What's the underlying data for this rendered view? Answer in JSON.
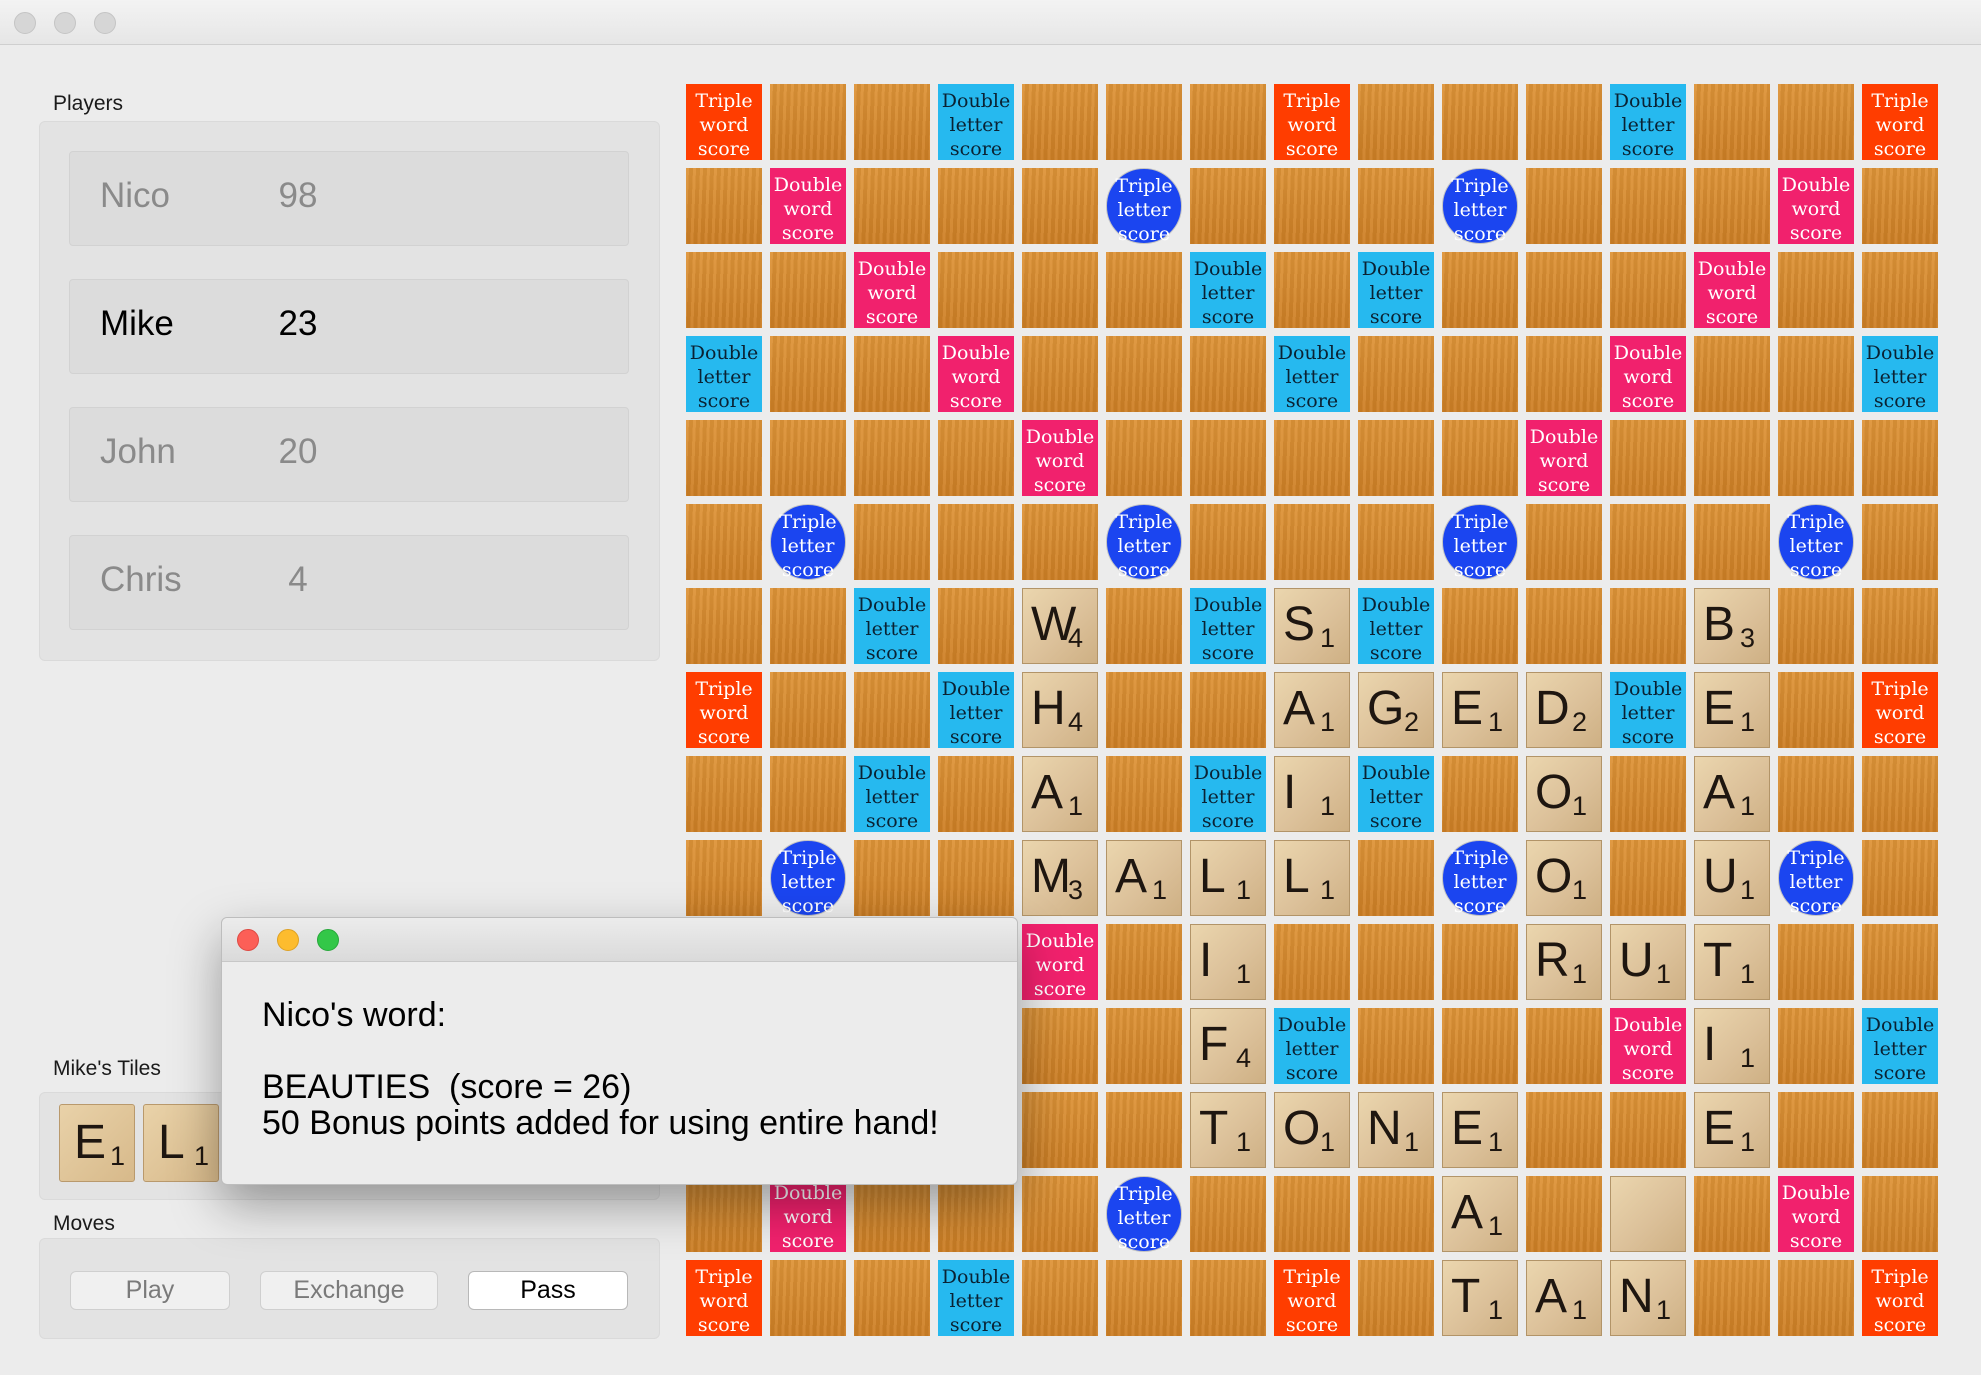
{
  "window": {
    "title": ""
  },
  "players": {
    "label": "Players",
    "list": [
      {
        "name": "Nico",
        "score": "98",
        "active": false
      },
      {
        "name": "Mike",
        "score": "23",
        "active": true
      },
      {
        "name": "John",
        "score": "20",
        "active": false
      },
      {
        "name": "Chris",
        "score": "4",
        "active": false
      }
    ]
  },
  "rack": {
    "label": "Mike's Tiles",
    "tiles": [
      {
        "letter": "E",
        "value": "1"
      },
      {
        "letter": "L",
        "value": "1"
      }
    ]
  },
  "moves": {
    "label": "Moves",
    "buttons": [
      {
        "label": "Play",
        "enabled": false
      },
      {
        "label": "Exchange",
        "enabled": false
      },
      {
        "label": "Pass",
        "enabled": true
      }
    ]
  },
  "premium_labels": {
    "TW": "Triple\nword\nscore",
    "DW": "Double\nword\nscore",
    "TL": "Triple\nletter\nscore",
    "DL": "Double\nletter\nscore"
  },
  "premium_colors": {
    "TW": "#ff3d00",
    "DW": "#f1216d",
    "TL": "#1b45f0",
    "DL": "#26b9ef",
    "plain": "#d88a30"
  },
  "board": {
    "size": 15,
    "premiums": [
      "TW . . DL . . . TW . . . DL . . TW",
      ". DW . . . TL . . . TL . . . DW .",
      ". . DW . . . DL . DL . . . DW . .",
      "DL . . DW . . . DL . . . DW . . DL",
      ". . . . DW . . . . . DW . . . .",
      ". TL . . . TL . . . TL . . . TL .",
      ". . DL . . . DL . DL . . . DL . .",
      "TW . . DL . . . DW . . . DL . . TW",
      ". . DL . . . DL . DL . . . DL . .",
      ". TL . . . TL . . . TL . . . TL .",
      ". . . . DW . . . . . DW . . . .",
      "DL . . DW . . . DL . . . DW . . DL",
      ". . DW . . . DL . DL . . . DW . .",
      ". DW . . . TL . . . TL . . . DW .",
      "TW . . DL . . . TW . . . DL . . TW"
    ],
    "tiles": [
      {
        "row": 6,
        "col": 4,
        "letter": "W",
        "value": "4"
      },
      {
        "row": 6,
        "col": 7,
        "letter": "S",
        "value": "1"
      },
      {
        "row": 6,
        "col": 12,
        "letter": "B",
        "value": "3"
      },
      {
        "row": 7,
        "col": 4,
        "letter": "H",
        "value": "4"
      },
      {
        "row": 7,
        "col": 7,
        "letter": "A",
        "value": "1"
      },
      {
        "row": 7,
        "col": 8,
        "letter": "G",
        "value": "2"
      },
      {
        "row": 7,
        "col": 9,
        "letter": "E",
        "value": "1"
      },
      {
        "row": 7,
        "col": 10,
        "letter": "D",
        "value": "2"
      },
      {
        "row": 7,
        "col": 12,
        "letter": "E",
        "value": "1"
      },
      {
        "row": 8,
        "col": 4,
        "letter": "A",
        "value": "1"
      },
      {
        "row": 8,
        "col": 7,
        "letter": "I",
        "value": "1"
      },
      {
        "row": 8,
        "col": 10,
        "letter": "O",
        "value": "1"
      },
      {
        "row": 8,
        "col": 12,
        "letter": "A",
        "value": "1"
      },
      {
        "row": 9,
        "col": 4,
        "letter": "M",
        "value": "3"
      },
      {
        "row": 9,
        "col": 5,
        "letter": "A",
        "value": "1"
      },
      {
        "row": 9,
        "col": 6,
        "letter": "L",
        "value": "1"
      },
      {
        "row": 9,
        "col": 7,
        "letter": "L",
        "value": "1"
      },
      {
        "row": 9,
        "col": 10,
        "letter": "O",
        "value": "1"
      },
      {
        "row": 9,
        "col": 12,
        "letter": "U",
        "value": "1"
      },
      {
        "row": 10,
        "col": 6,
        "letter": "I",
        "value": "1"
      },
      {
        "row": 10,
        "col": 10,
        "letter": "R",
        "value": "1"
      },
      {
        "row": 10,
        "col": 11,
        "letter": "U",
        "value": "1"
      },
      {
        "row": 10,
        "col": 12,
        "letter": "T",
        "value": "1"
      },
      {
        "row": 11,
        "col": 6,
        "letter": "F",
        "value": "4"
      },
      {
        "row": 11,
        "col": 12,
        "letter": "I",
        "value": "1"
      },
      {
        "row": 12,
        "col": 6,
        "letter": "T",
        "value": "1"
      },
      {
        "row": 12,
        "col": 7,
        "letter": "O",
        "value": "1"
      },
      {
        "row": 12,
        "col": 8,
        "letter": "N",
        "value": "1"
      },
      {
        "row": 12,
        "col": 9,
        "letter": "E",
        "value": "1"
      },
      {
        "row": 12,
        "col": 12,
        "letter": "E",
        "value": "1"
      },
      {
        "row": 13,
        "col": 9,
        "letter": "A",
        "value": "1"
      },
      {
        "row": 13,
        "col": 11,
        "letter": "",
        "value": ""
      },
      {
        "row": 14,
        "col": 9,
        "letter": "T",
        "value": "1"
      },
      {
        "row": 14,
        "col": 10,
        "letter": "A",
        "value": "1"
      },
      {
        "row": 14,
        "col": 11,
        "letter": "N",
        "value": "1"
      }
    ]
  },
  "dialog": {
    "heading": "Nico's word:",
    "word_line": "BEAUTIES  (score = 26)",
    "bonus_line": "50 Bonus points added for using entire hand!"
  }
}
